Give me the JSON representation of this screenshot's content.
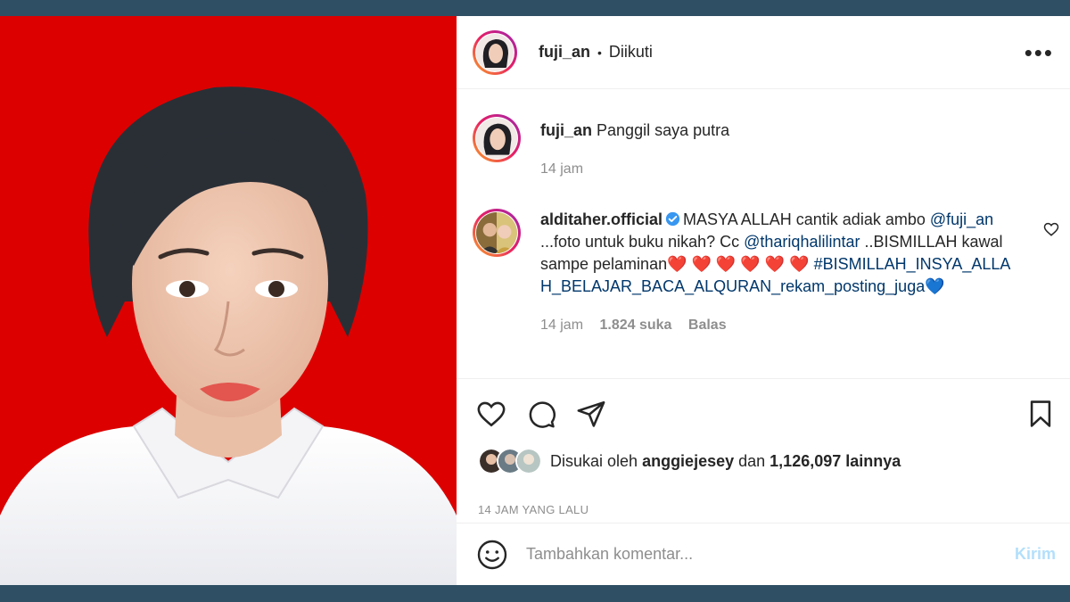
{
  "post": {
    "username": "fuji_an",
    "follow_status": "Diikuti",
    "more_label": "•••"
  },
  "comments": [
    {
      "user": "fuji_an",
      "text": "Panggil saya putra",
      "time": "14 jam"
    },
    {
      "user": "alditaher.official",
      "verified": true,
      "text_1": "MASYA ALLAH cantik adiak ambo ",
      "mention_1": "@fuji_an",
      "text_2": " ...foto untuk buku nikah? Cc ",
      "mention_2": "@thariqhalilintar",
      "text_3": " ..BISMILLAH kawal sampe pelaminan",
      "hearts": "❤️ ❤️ ❤️ ❤️ ❤️ ❤️",
      "hashtag": "#BISMILLAH_INSYA_ALLAH_BELAJAR_BACA_ALQURAN_rekam_posting_juga",
      "tail": "💙",
      "time": "14 jam",
      "likes": "1.824 suka",
      "reply": "Balas"
    }
  ],
  "likes": {
    "prefix": "Disukai oleh ",
    "user": "anggiejesey",
    "middle": " dan ",
    "count": "1,126,097 lainnya"
  },
  "timestamp": "14 JAM YANG LALU",
  "comment_box": {
    "placeholder": "Tambahkan komentar...",
    "send_label": "Kirim"
  },
  "colors": {
    "photo_background": "#dc0000",
    "link": "#00376b",
    "muted": "#8e8e8e",
    "send_disabled": "#b2dffc",
    "outer_frame": "#2f4f64"
  }
}
